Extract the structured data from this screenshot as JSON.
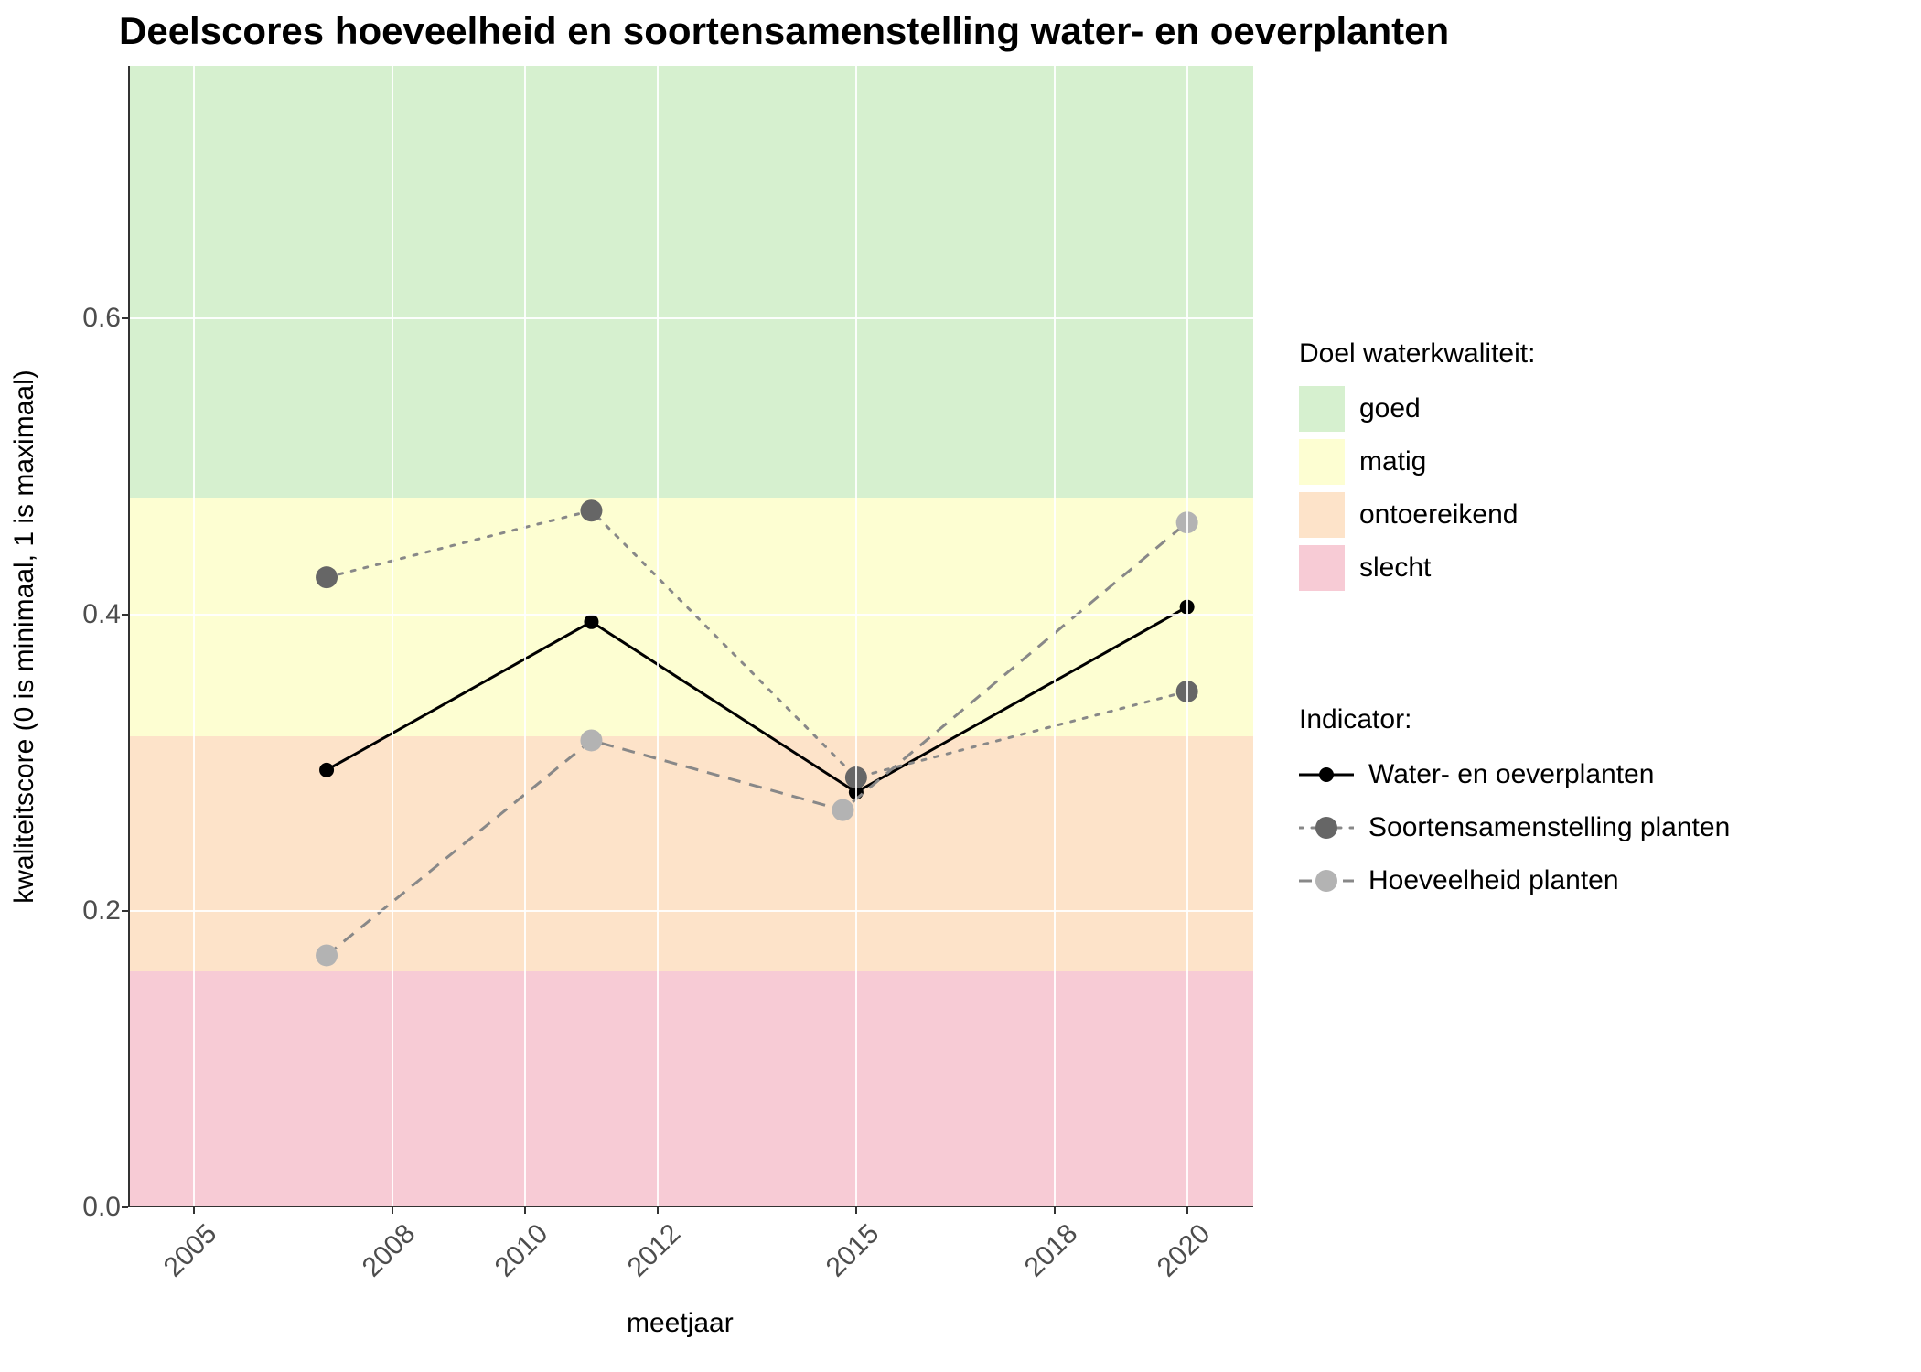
{
  "chart_data": {
    "type": "line",
    "title": "Deelscores hoeveelheid en soortensamenstelling water- en oeverplanten",
    "xlabel": "meetjaar",
    "ylabel": "kwaliteitscore (0 is minimaal, 1 is maximaal)",
    "x_ticks": [
      2005,
      2008,
      2010,
      2012,
      2015,
      2018,
      2020
    ],
    "y_ticks": [
      0.0,
      0.2,
      0.4,
      0.6
    ],
    "xlim": [
      2004,
      2021
    ],
    "ylim": [
      0.0,
      0.77
    ],
    "bands": [
      {
        "name": "goed",
        "from": 0.478,
        "to": 0.77,
        "color": "#d6f0cf"
      },
      {
        "name": "matig",
        "from": 0.318,
        "to": 0.478,
        "color": "#fdfed2"
      },
      {
        "name": "ontoereikend",
        "from": 0.159,
        "to": 0.318,
        "color": "#fde3c9"
      },
      {
        "name": "slecht",
        "from": 0.0,
        "to": 0.159,
        "color": "#f7cbd5"
      }
    ],
    "series": [
      {
        "name": "Water- en oeverplanten",
        "line_style": "solid",
        "point_color": "#000000",
        "x": [
          2007,
          2011,
          2015,
          2020
        ],
        "y": [
          0.295,
          0.395,
          0.28,
          0.405
        ]
      },
      {
        "name": "Soortensamenstelling planten",
        "line_style": "dotted",
        "point_color": "#666666",
        "x": [
          2007,
          2011,
          2015,
          2020
        ],
        "y": [
          0.425,
          0.47,
          0.29,
          0.348
        ]
      },
      {
        "name": "Hoeveelheid planten",
        "line_style": "dashed",
        "point_color": "#B3B3B3",
        "x": [
          2007,
          2011,
          2014.8,
          2020
        ],
        "y": [
          0.17,
          0.315,
          0.268,
          0.462
        ]
      }
    ],
    "legends": {
      "band_title": "Doel waterkwaliteit:",
      "band_items": [
        "goed",
        "matig",
        "ontoereikend",
        "slecht"
      ],
      "series_title": "Indicator:",
      "series_items": [
        "Water- en oeverplanten",
        "Soortensamenstelling planten",
        "Hoeveelheid planten"
      ]
    }
  }
}
